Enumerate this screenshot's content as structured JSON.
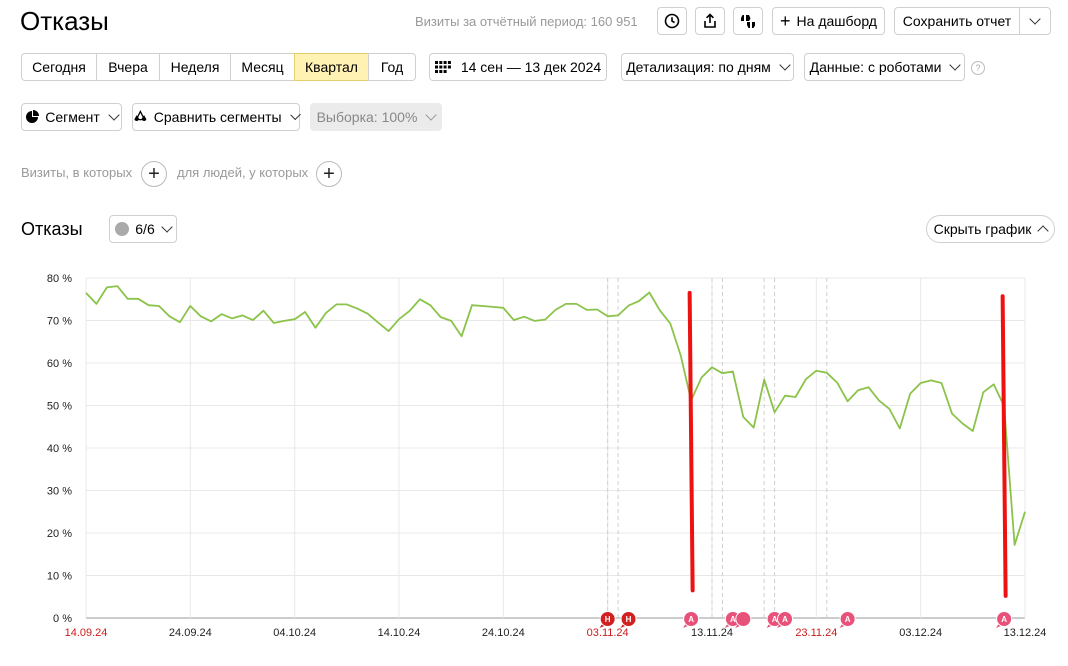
{
  "page": {
    "title": "Отказы"
  },
  "header": {
    "visits_label": "Визиты за отчётный период:",
    "visits_value": "160 951",
    "add_dashboard": "На дашборд",
    "save_report": "Сохранить отчет"
  },
  "periods": [
    "Сегодня",
    "Вчера",
    "Неделя",
    "Месяц",
    "Квартал",
    "Год"
  ],
  "active_period": "Квартал",
  "date_range": "14 сен — 13 дек 2024",
  "detail": "Детализация: по дням",
  "data_mode": "Данные: с роботами",
  "segment": {
    "segment_label": "Сегмент",
    "compare_label": "Сравнить сегменты",
    "sample_label": "Выборка: 100%"
  },
  "filters": {
    "visits_label": "Визиты, в которых",
    "people_label": "для людей, у которых"
  },
  "section": {
    "title": "Отказы",
    "series_count": "6/6",
    "hide_chart": "Скрыть график"
  },
  "chart_data": {
    "type": "line",
    "title": "",
    "ylim": [
      0,
      80
    ],
    "y_ticks": [
      "0 %",
      "10 %",
      "20 %",
      "30 %",
      "40 %",
      "50 %",
      "60 %",
      "70 %",
      "80 %"
    ],
    "x_ticks": [
      {
        "label": "14.09.24",
        "index": 0,
        "weekend": true
      },
      {
        "label": "24.09.24",
        "index": 10,
        "weekend": false
      },
      {
        "label": "04.10.24",
        "index": 20,
        "weekend": false
      },
      {
        "label": "14.10.24",
        "index": 30,
        "weekend": false
      },
      {
        "label": "24.10.24",
        "index": 40,
        "weekend": false
      },
      {
        "label": "03.11.24",
        "index": 50,
        "weekend": true
      },
      {
        "label": "13.11.24",
        "index": 60,
        "weekend": false
      },
      {
        "label": "23.11.24",
        "index": 70,
        "weekend": true
      },
      {
        "label": "03.12.24",
        "index": 80,
        "weekend": false
      },
      {
        "label": "13.12.24",
        "index": 90,
        "weekend": false
      }
    ],
    "x_start": "2024-09-14",
    "x_end": "2024-12-13",
    "series_color": "#8bc34a",
    "values": [
      76.5,
      73.9,
      77.8,
      78.1,
      75.1,
      75.1,
      73.6,
      73.4,
      71.0,
      69.6,
      73.4,
      71.0,
      69.8,
      71.5,
      70.5,
      71.2,
      70.1,
      72.3,
      69.4,
      69.9,
      70.3,
      72.0,
      68.3,
      71.8,
      73.8,
      73.8,
      72.8,
      71.6,
      69.5,
      67.5,
      70.3,
      72.2,
      75.0,
      73.6,
      70.8,
      69.9,
      66.3,
      73.6,
      73.4,
      73.2,
      73.0,
      70.1,
      70.9,
      69.9,
      70.2,
      72.5,
      73.9,
      73.9,
      72.5,
      72.6,
      71.0,
      71.2,
      73.5,
      74.6,
      76.6,
      72.4,
      69.3,
      61.8,
      51.2,
      56.6,
      59.0,
      57.6,
      58.0,
      47.3,
      44.8,
      56.1,
      48.4,
      52.3,
      52.0,
      56.2,
      58.2,
      57.7,
      55.4,
      51.0,
      53.6,
      54.3,
      51.2,
      49.2,
      44.6,
      52.8,
      55.3,
      55.9,
      55.3,
      48.1,
      45.8,
      44.0,
      53.1,
      55.0,
      49.8,
      17.2,
      25.0
    ],
    "vlines": [
      50,
      51,
      60,
      61,
      65,
      66,
      71
    ],
    "annotations": [
      {
        "index": 50,
        "letter": "Н",
        "color": "#d21f1f"
      },
      {
        "index": 52,
        "letter": "Н",
        "color": "#d21f1f"
      },
      {
        "index": 58,
        "letter": "А",
        "color": "#e8527a"
      },
      {
        "index": 62,
        "letter": "А",
        "color": "#e8527a"
      },
      {
        "index": 63,
        "letter": "",
        "color": "#e8527a"
      },
      {
        "index": 66,
        "letter": "А",
        "color": "#e8527a"
      },
      {
        "index": 67,
        "letter": "А",
        "color": "#e8527a"
      },
      {
        "index": 73,
        "letter": "А",
        "color": "#e8527a"
      },
      {
        "index": 88,
        "letter": "А",
        "color": "#e8527a"
      }
    ],
    "red_marks": [
      {
        "index": 58,
        "from": 76.5,
        "to": 6.5
      },
      {
        "index": 88,
        "from": 75.7,
        "to": 5.2
      }
    ]
  }
}
